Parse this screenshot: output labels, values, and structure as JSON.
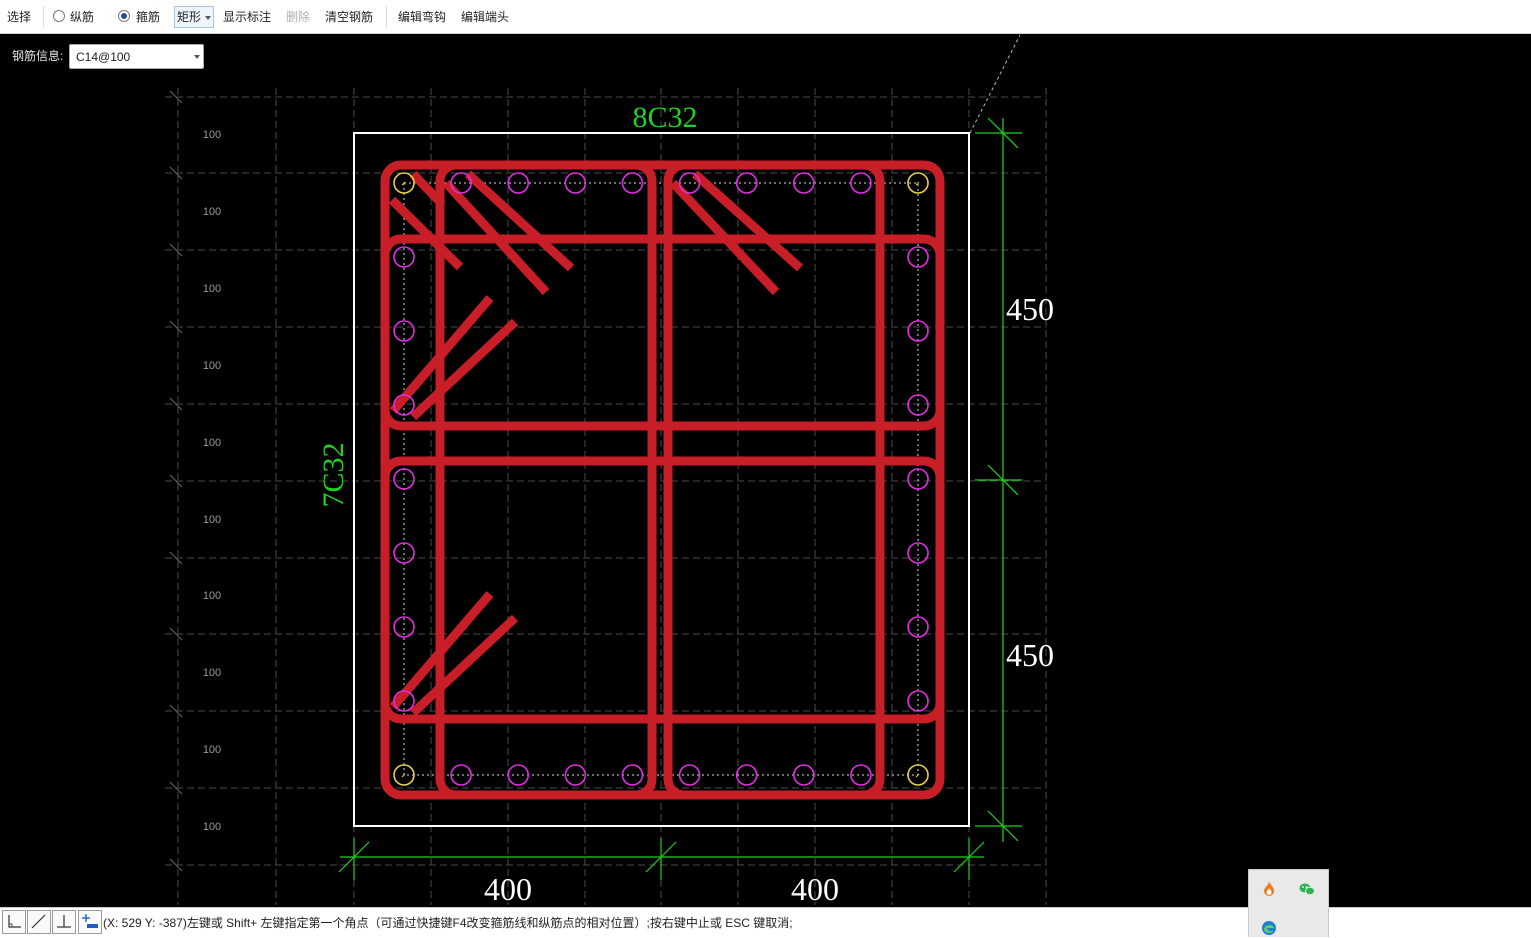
{
  "toolbar": {
    "select_label": "选择",
    "mode_options": [
      {
        "label": "纵筋",
        "checked": false
      },
      {
        "label": "箍筋",
        "checked": true
      }
    ],
    "shape_dropdown": "矩形",
    "show_dims_label": "显示标注",
    "delete_label": "删除",
    "clear_label": "清空钢筋",
    "edit_hook_label": "编辑弯钩",
    "edit_end_label": "编辑端头"
  },
  "rebar_info": {
    "label": "钢筋信息:",
    "value": "C14@100"
  },
  "canvas": {
    "grid_labels": [
      "100",
      "100",
      "100",
      "100",
      "100",
      "100",
      "100",
      "100",
      "100",
      "100"
    ],
    "top_rebar_label": "8C32",
    "side_rebar_label": "7C32",
    "dim_right": [
      "450",
      "450"
    ],
    "dim_bottom": [
      "400",
      "400"
    ]
  },
  "status": {
    "icons": [
      "ortho-icon",
      "line-icon",
      "perpendicular-icon",
      "add-point-icon"
    ],
    "text": "(X: 529 Y: -387)左键或 Shift+ 左键指定第一个角点（可通过快捷键F4改变箍筋线和纵筋点的相对位置）;按右键中止或 ESC 键取消;"
  },
  "tray_icons": [
    "fire-icon",
    "wechat-icon",
    "edge-browser-icon"
  ],
  "colors": {
    "stirrup": "#c81e28",
    "rebar": "#e22ee2",
    "corner_rebar": "#e8d048",
    "dimension": "#22d022",
    "outline": "#ffffff"
  }
}
